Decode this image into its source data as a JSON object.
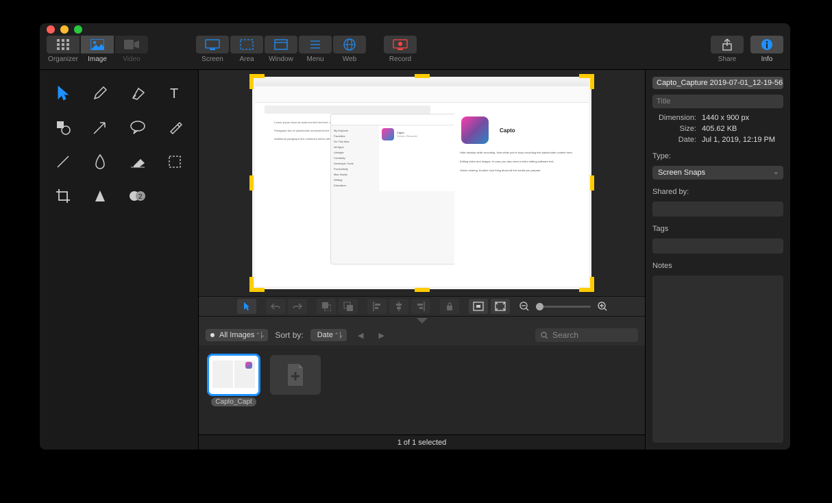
{
  "toolbar": {
    "view": [
      {
        "id": "organizer",
        "label": "Organizer"
      },
      {
        "id": "image",
        "label": "Image"
      },
      {
        "id": "video",
        "label": "Video"
      }
    ],
    "capture": [
      {
        "id": "screen",
        "label": "Screen"
      },
      {
        "id": "area",
        "label": "Area"
      },
      {
        "id": "window",
        "label": "Window"
      },
      {
        "id": "menu",
        "label": "Menu"
      },
      {
        "id": "web",
        "label": "Web"
      }
    ],
    "record": {
      "label": "Record"
    },
    "share": {
      "label": "Share"
    },
    "info": {
      "label": "Info"
    }
  },
  "filter": {
    "images_select": "All Images",
    "sort_by_label": "Sort by:",
    "sort_value": "Date",
    "search_placeholder": "Search"
  },
  "thumb": {
    "caption": "Capto_Capt"
  },
  "status": {
    "text": "1 of 1 selected"
  },
  "inspector": {
    "filename": "Capto_Capture 2019-07-01_12-19-56",
    "title_placeholder": "Title",
    "dimension_label": "Dimension:",
    "dimension_value": "1440 x 900 px",
    "size_label": "Size:",
    "size_value": "405.62 KB",
    "date_label": "Date:",
    "date_value": "Jul 1, 2019, 12:19 PM",
    "type_label": "Type:",
    "type_value": "Screen Snaps",
    "shared_label": "Shared by:",
    "tags_label": "Tags",
    "notes_label": "Notes"
  }
}
